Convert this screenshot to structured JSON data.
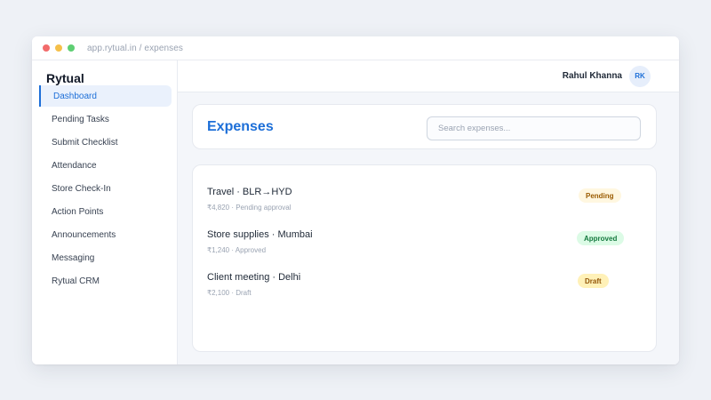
{
  "browser": {
    "url": "app.rytual.in / expenses"
  },
  "sidebar": {
    "brand": "Rytual",
    "items": [
      {
        "label": "Dashboard",
        "active": true
      },
      {
        "label": "Pending Tasks"
      },
      {
        "label": "Submit Checklist"
      },
      {
        "label": "Attendance"
      },
      {
        "label": "Store Check-In"
      },
      {
        "label": "Action Points"
      },
      {
        "label": "Announcements"
      },
      {
        "label": "Messaging"
      },
      {
        "label": "Rytual CRM"
      }
    ]
  },
  "topbar": {
    "user_name": "Rahul Khanna",
    "user_initials": "RK"
  },
  "header": {
    "title": "Expenses",
    "search_placeholder": "Search expenses..."
  },
  "expenses": [
    {
      "title": "Travel · BLR→HYD",
      "subtitle": "₹4,820 · Pending approval",
      "status": "Pending"
    },
    {
      "title": "Store supplies · Mumbai",
      "subtitle": "₹1,240 · Approved",
      "status": "Approved"
    },
    {
      "title": "Client meeting · Delhi",
      "subtitle": "₹2,100 · Draft",
      "status": "Draft"
    }
  ],
  "colors": {
    "accent": "#1d6fd8",
    "pending": "#fff7e0",
    "approved": "#dcfbe6",
    "draft": "#fff1b8"
  }
}
